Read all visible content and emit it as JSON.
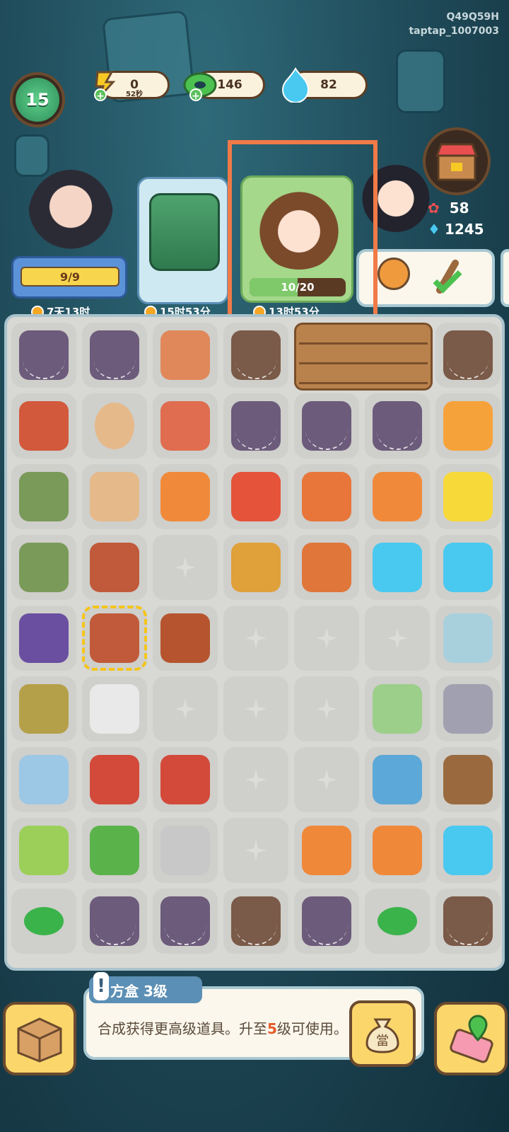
{
  "watermark": {
    "line1": "Q49Q59H",
    "line2": "taptap_1007003"
  },
  "player": {
    "level": "15"
  },
  "resources": [
    {
      "name": "energy",
      "value": "0",
      "sub": "52秒",
      "icon": "lightning-icon",
      "color": "#f7c925"
    },
    {
      "name": "coins",
      "value": "146",
      "icon": "green-coin-icon",
      "color": "#4cc150"
    },
    {
      "name": "flame",
      "value": "82",
      "icon": "blue-flame-icon",
      "color": "#49c8f0"
    }
  ],
  "characters": [
    {
      "progress": "9/9",
      "progress_fraction": 1.0,
      "timer": "7天13时"
    },
    {
      "timer": "15时53分"
    },
    {
      "progress": "10/20",
      "progress_fraction": 0.5,
      "timer": "13时53分"
    }
  ],
  "shop": {
    "roses": "58",
    "flames": "1245"
  },
  "info": {
    "title": "方盒 3级",
    "desc_part1": "合成获得更高级道具。升至",
    "desc_em": "5",
    "desc_part2": "级可使用。"
  },
  "colors": {
    "highlight": "#f07a48",
    "board": "#d8d8d4"
  }
}
